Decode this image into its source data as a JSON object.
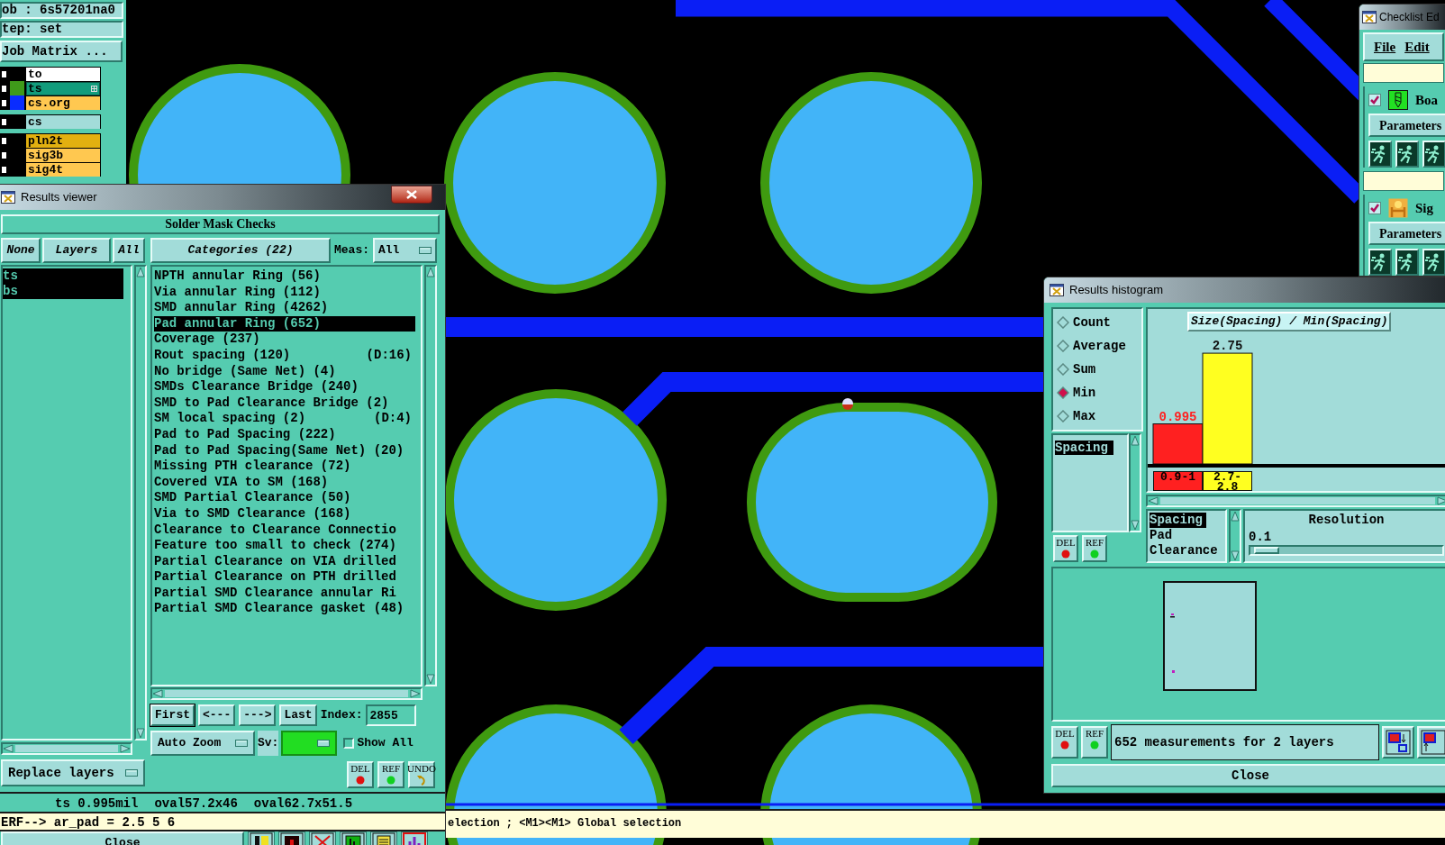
{
  "job_panel": {
    "job": "ob : 6s57201na0",
    "step": "tep: set",
    "matrix_button": "Job Matrix ...",
    "layer_groups": [
      [
        {
          "name": "to",
          "checked": false,
          "selected": false,
          "color": "#ffffff"
        },
        {
          "name": "ts",
          "checked": false,
          "selected": true,
          "color": "#129c7c",
          "swatch": {
            "color": "#3f9a1a"
          }
        },
        {
          "name": "cs.org",
          "checked": false,
          "selected": false,
          "color": "#ffc850",
          "swatch": {
            "color": "#0a2cff"
          }
        }
      ],
      [
        {
          "name": "cs",
          "checked": false,
          "selected": false,
          "color": "#a2dcd9"
        }
      ],
      [
        {
          "name": "pln2t",
          "checked": false,
          "selected": false,
          "color": "#e2b010"
        },
        {
          "name": "sig3b",
          "checked": false,
          "selected": false,
          "color": "#ffc850"
        },
        {
          "name": "sig4t",
          "checked": false,
          "selected": false,
          "color": "#ffc850"
        }
      ]
    ]
  },
  "results_viewer": {
    "title": "Results viewer",
    "heading": "Solder Mask Checks",
    "layer_buttons": [
      {
        "label": "None"
      },
      {
        "label": "Layers"
      },
      {
        "label": "All"
      }
    ],
    "layers": [
      {
        "name": "ts",
        "selected": true
      },
      {
        "name": "bs",
        "selected": true
      }
    ],
    "categories_button": "Categories (22)",
    "meas_label": "Meas:",
    "meas_value": "All",
    "categories": [
      {
        "label": "NPTH annular Ring (56)",
        "selected": false
      },
      {
        "label": "Via annular Ring (112)",
        "selected": false
      },
      {
        "label": "SMD annular Ring (4262)",
        "selected": false
      },
      {
        "label": "Pad annular Ring (652)",
        "selected": true
      },
      {
        "label": "Coverage (237)",
        "selected": false
      },
      {
        "label": "Rout spacing (120)",
        "note": "(D:16)",
        "selected": false
      },
      {
        "label": "No bridge (Same Net) (4)",
        "selected": false
      },
      {
        "label": "SMDs Clearance Bridge (240)",
        "selected": false
      },
      {
        "label": "SMD to Pad Clearance Bridge (2)",
        "selected": false
      },
      {
        "label": "SM local spacing (2)",
        "note": "(D:4)",
        "selected": false
      },
      {
        "label": "Pad to Pad Spacing (222)",
        "selected": false
      },
      {
        "label": "Pad to Pad Spacing(Same Net) (20)",
        "selected": false
      },
      {
        "label": "Missing PTH clearance (72)",
        "selected": false
      },
      {
        "label": "Covered VIA to SM (168)",
        "selected": false
      },
      {
        "label": "SMD Partial Clearance (50)",
        "selected": false
      },
      {
        "label": "Via to SMD Clearance (168)",
        "selected": false
      },
      {
        "label": "Clearance to Clearance Connectio",
        "selected": false
      },
      {
        "label": "Feature too small to check (274)",
        "selected": false
      },
      {
        "label": "Partial Clearance on VIA drilled",
        "selected": false
      },
      {
        "label": "Partial Clearance on PTH drilled",
        "selected": false
      },
      {
        "label": "Partial SMD Clearance annular Ri",
        "selected": false
      },
      {
        "label": "Partial SMD Clearance gasket (48)",
        "selected": false
      }
    ],
    "nav_buttons": [
      "First",
      "<---",
      "--->",
      "Last"
    ],
    "index_label": "Index:",
    "index_value": "2855",
    "zoom_mode": "Auto Zoom",
    "sv_label": "Sv:",
    "show_all": {
      "label": "Show All",
      "checked": false
    },
    "replace_layers": "Replace layers",
    "tool_buttons": [
      {
        "label": "DEL",
        "kind": "delete"
      },
      {
        "label": "REF",
        "kind": "refer"
      },
      {
        "label": "UNDO",
        "kind": "undo"
      }
    ],
    "status_items": [
      "ts 0.995mil",
      "oval57.2x46",
      "oval62.7x51.5"
    ],
    "command_line": "ERF--> ar_pad = 2.5 5 6",
    "close_button": "Close"
  },
  "message_bar": "election ; <M1><M1> Global selection",
  "histogram": {
    "title": "Results histogram",
    "modes": [
      {
        "label": "Count",
        "selected": false
      },
      {
        "label": "Average",
        "selected": false
      },
      {
        "label": "Sum",
        "selected": false
      },
      {
        "label": "Min",
        "selected": true
      },
      {
        "label": "Max",
        "selected": false
      }
    ],
    "measures": [
      {
        "label": "Spacing",
        "selected": true
      }
    ],
    "side_buttons": [
      {
        "label": "DEL",
        "kind": "delete"
      },
      {
        "label": "REF",
        "kind": "refer"
      }
    ],
    "chart_data": {
      "type": "bar",
      "title": "Size(Spacing) / Min(Spacing)",
      "categories": [
        "0.9-1",
        "2.7-2.8"
      ],
      "stacked": true,
      "data_labels": true,
      "series": [
        {
          "color": "#ff2020",
          "values": [
            0.995,
            null
          ]
        },
        {
          "color": "#ffff20",
          "values": [
            null,
            2.75
          ]
        }
      ]
    },
    "attributes": [
      {
        "label": "Spacing",
        "selected": true
      },
      {
        "label": "Pad",
        "selected": false
      },
      {
        "label": "Clearance",
        "selected": false
      }
    ],
    "resolution_label": "Resolution",
    "resolution_value": "0.1",
    "resolution_slider": {
      "level": 0.02
    },
    "bottom_buttons": [
      {
        "label": "DEL",
        "kind": "delete"
      },
      {
        "label": "REF",
        "kind": "refer"
      }
    ],
    "summary": "652 measurements for 2 layers",
    "close_button": "Close"
  },
  "checklist": {
    "title": "Checklist Ed",
    "menu": [
      "File",
      "Edit"
    ],
    "sections": [
      {
        "label": "Boa",
        "checked": true,
        "kind": "drill",
        "parameters": "Parameters"
      },
      {
        "label": "Sig",
        "checked": true,
        "kind": "signal",
        "parameters": "Parameters"
      }
    ]
  }
}
